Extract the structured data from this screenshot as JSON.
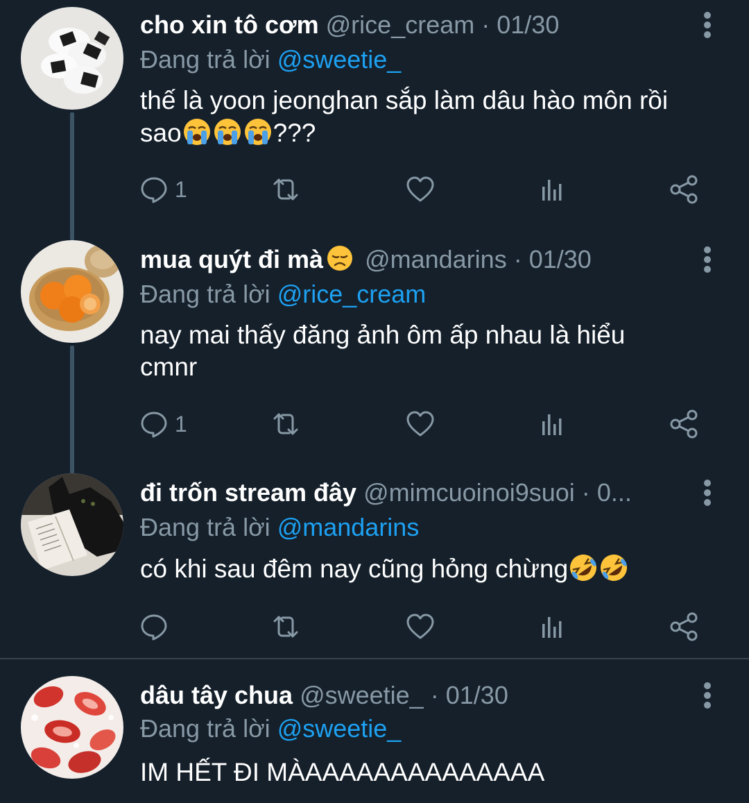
{
  "tweets": [
    {
      "name": "cho xin tô cơm",
      "handle": "@rice_cream",
      "dot": "·",
      "date": "01/30",
      "reply_prefix": "Đang trả lời",
      "reply_to": "@sweetie_",
      "text_parts": [
        "thế là yoon jeonghan sắp làm dâu hào môn rồi",
        "sao",
        "???"
      ],
      "emoji": "loudly-crying-face",
      "reply_count": "1",
      "avatar": "onigiri-rice-balls"
    },
    {
      "name": "mua quýt đi mà",
      "name_emoji": "disappointed-face",
      "handle": "@mandarins",
      "dot": "·",
      "date": "01/30",
      "reply_prefix": "Đang trả lời",
      "reply_to": "@rice_cream",
      "text_parts": [
        "nay mai thấy đăng ảnh ôm ấp nhau là hiểu",
        "cmnr"
      ],
      "reply_count": "1",
      "avatar": "mandarin-basket"
    },
    {
      "name": "đi trốn stream đây",
      "handle": "@mimcuoinoi9suoi",
      "dot": "·",
      "date": "0...",
      "reply_prefix": "Đang trả lời",
      "reply_to": "@mandarins",
      "text_parts": [
        "có khi sau đêm nay cũng hỏng chừng"
      ],
      "emoji": "rolling-on-floor-laughing",
      "reply_count": "",
      "avatar": "black-cat-with-book"
    },
    {
      "name": "dâu tây chua",
      "handle": "@sweetie_",
      "dot": "·",
      "date": "01/30",
      "reply_prefix": "Đang trả lời",
      "reply_to": "@sweetie_",
      "text_parts": [
        "IM HẾT ĐI MÀAAAAAAAAAAAAAA"
      ],
      "avatar": "strawberries-in-milk"
    }
  ],
  "icons": {
    "reply": "reply-icon",
    "retweet": "retweet-icon",
    "like": "heart-icon",
    "analytics": "analytics-icon",
    "share": "share-icon",
    "more": "more-icon"
  },
  "colors": {
    "background": "#15202b",
    "muted": "#8899a6",
    "link": "#1da1f2",
    "thread_line": "#3d5466"
  }
}
